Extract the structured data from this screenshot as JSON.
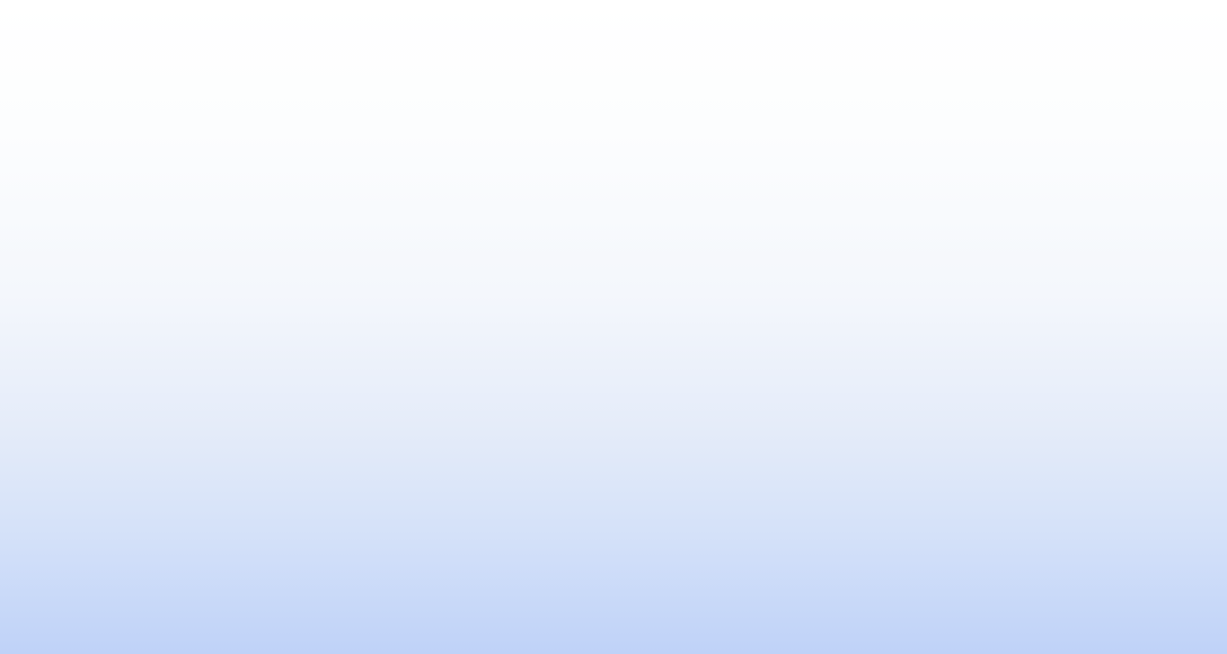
{
  "background": {
    "colors": [
      "#ffffff",
      "#f4f7fc",
      "#e5ecf9",
      "#d4e1f9",
      "#bfd2f8"
    ]
  }
}
